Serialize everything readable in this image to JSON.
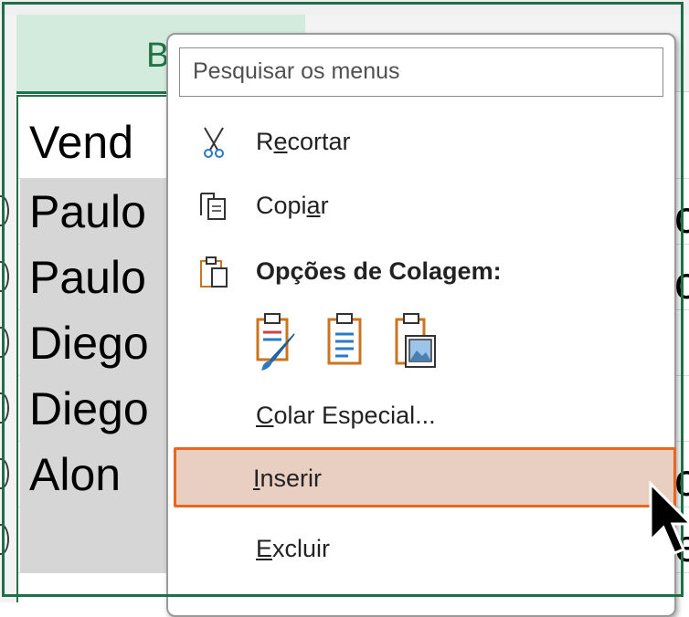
{
  "sheet": {
    "column_letter": "B",
    "cells": [
      "Vend",
      "Paulo",
      "Paulo",
      "Diego",
      "Diego",
      "Alon"
    ],
    "right_edge_glyphs": [
      "c",
      "c",
      "c",
      "e"
    ]
  },
  "context_menu": {
    "search_placeholder": "Pesquisar os menus",
    "items": {
      "cut": {
        "prefix": "R",
        "underline": "e",
        "suffix": "cortar"
      },
      "copy": {
        "prefix": "Copi",
        "underline": "a",
        "suffix": "r"
      },
      "paste_options": "Opções de Colagem:",
      "paste_special": {
        "underline": "C",
        "suffix": "olar Especial..."
      },
      "insert": {
        "underline": "I",
        "suffix": "nserir"
      },
      "delete": {
        "underline": "E",
        "suffix": "xcluir"
      }
    },
    "icons": [
      "scissors-icon",
      "copy-icon",
      "clipboard-icon",
      "paste-formatting-icon",
      "paste-values-icon",
      "paste-picture-icon"
    ],
    "highlight_color": "#e8cfc2",
    "highlight_border": "#e8661e"
  },
  "theme": {
    "accent": "#217346"
  }
}
